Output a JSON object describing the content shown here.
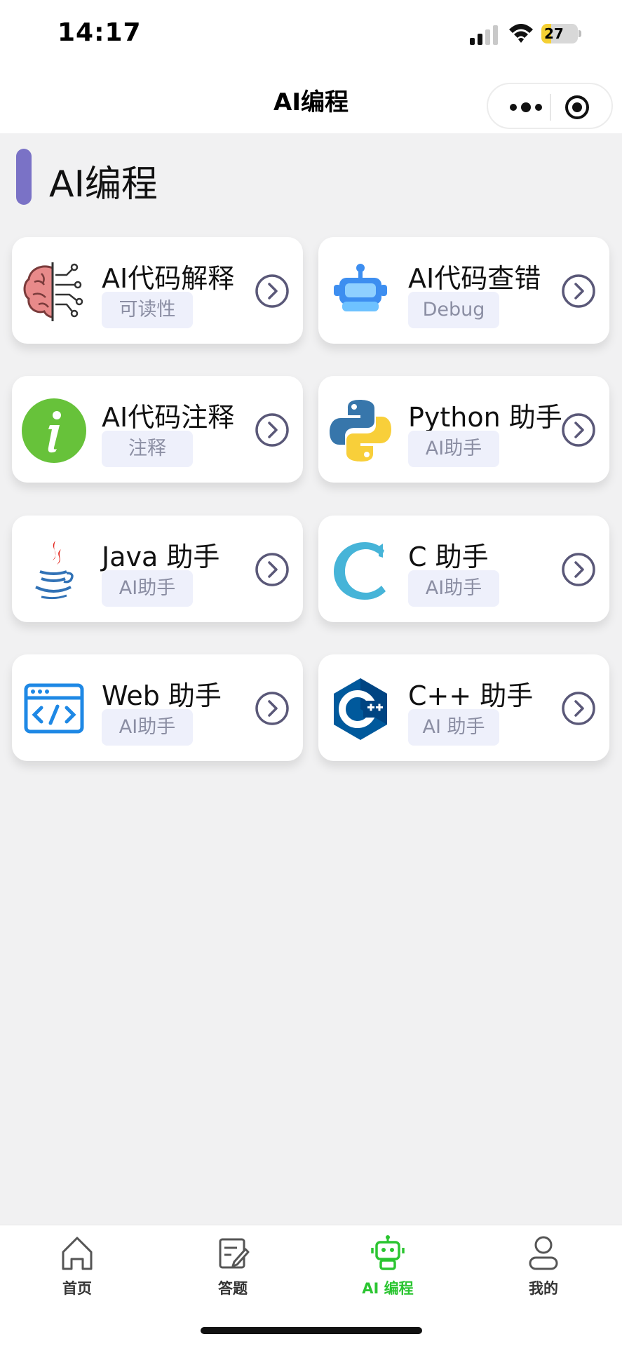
{
  "status_bar": {
    "time": "14:17",
    "battery_percent": "27",
    "battery_level": 0.27
  },
  "nav": {
    "title": "AI编程",
    "more_icon": "more-dots-icon",
    "close_icon": "target-circle-icon"
  },
  "section": {
    "title": "AI编程",
    "accent_color": "#7a72c6"
  },
  "cards": [
    {
      "title": "AI代码解释",
      "tag": "可读性",
      "icon": "brain-circuit-icon"
    },
    {
      "title": "AI代码查错",
      "tag": "Debug",
      "icon": "robot-icon"
    },
    {
      "title": "AI代码注释",
      "tag": "注释",
      "icon": "info-icon"
    },
    {
      "title": "Python 助手",
      "tag": "AI助手",
      "icon": "python-icon"
    },
    {
      "title": "Java 助手",
      "tag": "AI助手",
      "icon": "java-icon"
    },
    {
      "title": "C 助手",
      "tag": "AI助手",
      "icon": "c-letter-icon"
    },
    {
      "title": "Web 助手",
      "tag": "AI助手",
      "icon": "web-code-icon"
    },
    {
      "title": "C++ 助手",
      "tag": "AI 助手",
      "icon": "cplusplus-icon"
    }
  ],
  "tabs": [
    {
      "label": "首页",
      "icon": "home-icon",
      "active": false
    },
    {
      "label": "答题",
      "icon": "edit-note-icon",
      "active": false
    },
    {
      "label": "AI 编程",
      "icon": "robot-icon",
      "active": true
    },
    {
      "label": "我的",
      "icon": "user-icon",
      "active": false
    }
  ],
  "colors": {
    "active_tab": "#2bc531",
    "tag_bg": "#eef0fb",
    "arrow": "#5a5878"
  }
}
